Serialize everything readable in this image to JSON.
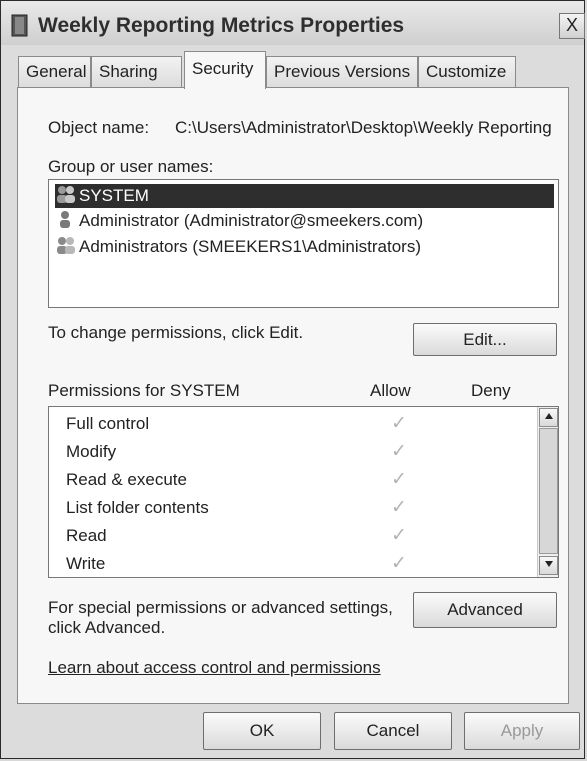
{
  "window": {
    "title": "Weekly Reporting Metrics Properties",
    "close_label": "X"
  },
  "tabs": [
    "General",
    "Sharing",
    "Security",
    "Previous Versions",
    "Customize"
  ],
  "security": {
    "object_label": "Object name:",
    "object_value": "C:\\Users\\Administrator\\Desktop\\Weekly Reporting",
    "group_label": "Group or user names:",
    "users": [
      "SYSTEM",
      "Administrator (Administrator@smeekers.com)",
      "Administrators (SMEEKERS1\\Administrators)"
    ],
    "change_text": "To change permissions, click Edit.",
    "edit_label": "Edit...",
    "permissions_header": "Permissions for SYSTEM",
    "allow_header": "Allow",
    "deny_header": "Deny",
    "permissions": [
      "Full control",
      "Modify",
      "Read & execute",
      "List folder contents",
      "Read",
      "Write"
    ],
    "check_glyph": "✓",
    "special_text_line1": "For special permissions or advanced settings,",
    "special_text_line2": "click Advanced.",
    "advanced_label": "Advanced",
    "learn_link": "Learn about access control and permissions"
  },
  "footer": {
    "ok": "OK",
    "cancel": "Cancel",
    "apply": "Apply"
  }
}
